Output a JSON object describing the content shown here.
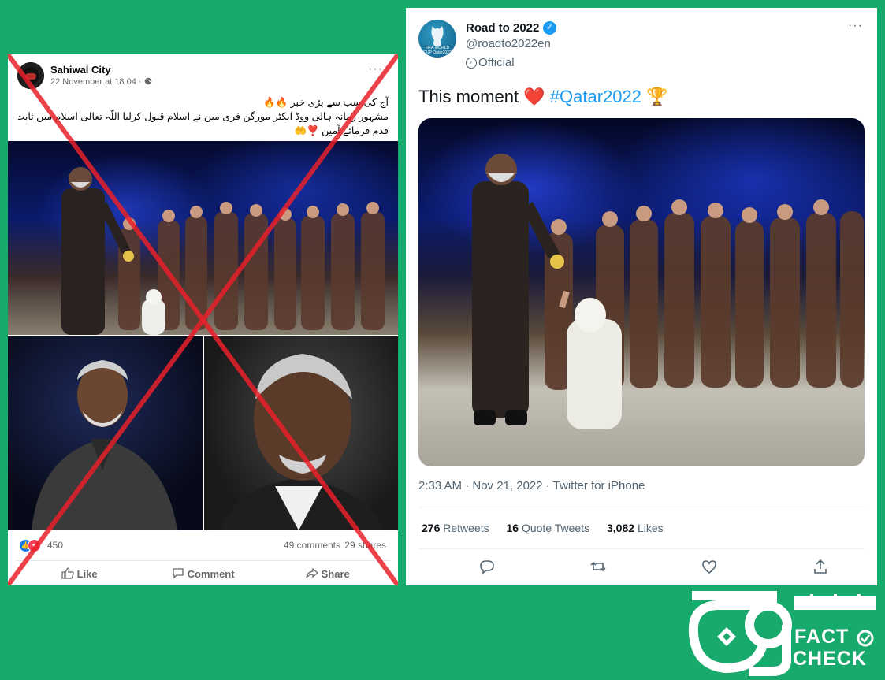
{
  "facebook_post": {
    "page_name": "Sahiwal City",
    "timestamp": "22 November at 18:04 ·",
    "more": "···",
    "text_lines": [
      "آج کی سب سے بڑی خبر 🔥🔥",
      "مشہور زمانہ ہالی ووڈ ایکٹر مورگن فری مین نے اسلام قبول کرلیا اللّہ تعالی اسلام میں ثابت",
      "قدم فرمائے آمین ❣️🤲"
    ],
    "reaction_count": "450",
    "comments": "49 comments",
    "shares": "29 shares",
    "actions": {
      "like": "Like",
      "comment": "Comment",
      "share": "Share"
    },
    "reaction_colors": {
      "like": "#1877f2",
      "love": "#f33e58"
    },
    "cross_color": "#e8202a"
  },
  "tweet": {
    "display_name": "Road to 2022",
    "avatar_text": "FIFA WORLD CUP Qatar2022",
    "handle": "@roadto2022en",
    "label": "Official",
    "more": "···",
    "text": "This moment",
    "heart": "❤️",
    "hashtag": "#Qatar2022",
    "trophy": "🏆",
    "timestamp": "2:33 AM · Nov 21, 2022 · Twitter for iPhone",
    "retweets_count": "276",
    "retweets_label": "Retweets",
    "quote_count": "16",
    "quote_label": "Quote Tweets",
    "likes_count": "3,082",
    "likes_label": "Likes",
    "link_color": "#1d9bf0",
    "verified_color": "#1d9bf0"
  },
  "logo": {
    "fact": "FACT",
    "check": "CHECK"
  },
  "background_color": "#18a96c"
}
